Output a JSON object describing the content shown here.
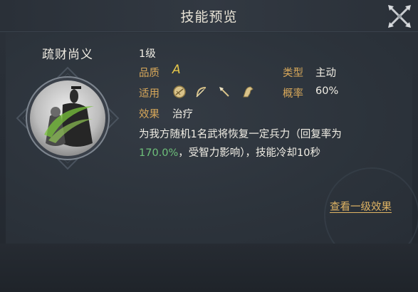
{
  "header": {
    "title": "技能预览"
  },
  "skill": {
    "name": "疏财尚义",
    "level": "1级",
    "quality_label": "品质",
    "quality_value": "A",
    "type_label": "类型",
    "type_value": "主动",
    "applicable_label": "适用",
    "applicable_icons": [
      "shield-unit-icon",
      "bow-unit-icon",
      "spear-unit-icon",
      "cavalry-unit-icon"
    ],
    "chance_label": "概率",
    "chance_value": "60%",
    "effect_label": "效果",
    "effect_value": "治疗",
    "desc_line1": "为我方随机1名武将恢复一定兵力（回复率为",
    "desc_highlight": "170.0%",
    "desc_line2_rest": "，受智力影响），技能冷却10秒"
  },
  "actions": {
    "view_level1": "查看一级效果"
  },
  "colors": {
    "label": "#d8a85a",
    "text": "#f2efe6",
    "highlight": "#6ec07a",
    "grade": "#e6c74a",
    "link": "#e1b564"
  }
}
